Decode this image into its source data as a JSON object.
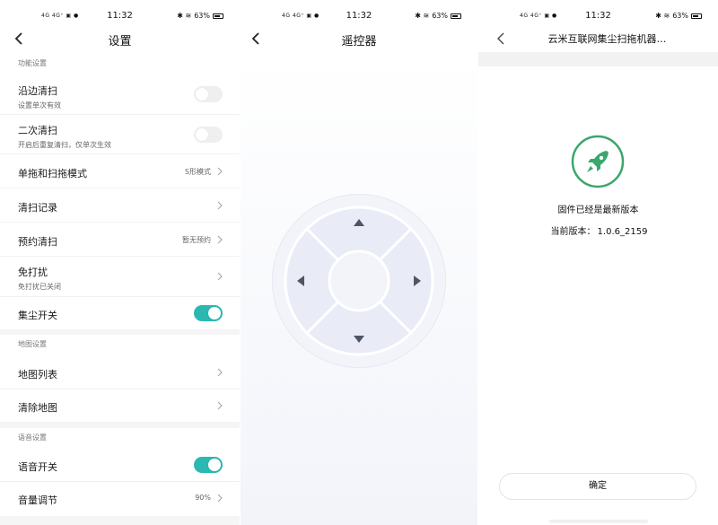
{
  "status": {
    "time": "11:32",
    "battery": "63%",
    "signal_left": "4G 4G⁺ ▣ ●",
    "network_speed": [
      "17.5 K/s",
      "2.90 K/s",
      "1.48 K/s"
    ]
  },
  "settings": {
    "title": "设置",
    "sections": [
      {
        "header": "功能设置"
      },
      {
        "header": "地图设置"
      },
      {
        "header": "语音设置"
      }
    ],
    "rows": [
      {
        "title": "沿边清扫",
        "subtitle": "设置单次有效",
        "control": "toggle",
        "on": false
      },
      {
        "title": "二次清扫",
        "subtitle": "开启后重复清扫，仅单次生效",
        "control": "toggle",
        "on": false
      },
      {
        "title": "单拖和扫拖模式",
        "value": "S形模式",
        "control": "chevron"
      },
      {
        "title": "清扫记录",
        "control": "chevron"
      },
      {
        "title": "预约清扫",
        "value": "暂无预约",
        "control": "chevron"
      },
      {
        "title": "免打扰",
        "subtitle": "免打扰已关闭",
        "control": "chevron"
      },
      {
        "title": "集尘开关",
        "control": "toggle",
        "on": true
      },
      {
        "title": "地图列表",
        "control": "chevron"
      },
      {
        "title": "清除地图",
        "control": "chevron"
      },
      {
        "title": "语音开关",
        "control": "toggle",
        "on": true
      },
      {
        "title": "音量调节",
        "value": "90%",
        "control": "chevron"
      }
    ]
  },
  "remote": {
    "title": "遥控器"
  },
  "firmware": {
    "title": "云米互联网集尘扫拖机器…",
    "message": "固件已经是最新版本",
    "version_label": "当前版本：",
    "version": "1.0.6_2159",
    "confirm": "确定"
  },
  "colors": {
    "accent": "#2bb8b3",
    "rocket_green": "#3aa76d"
  }
}
